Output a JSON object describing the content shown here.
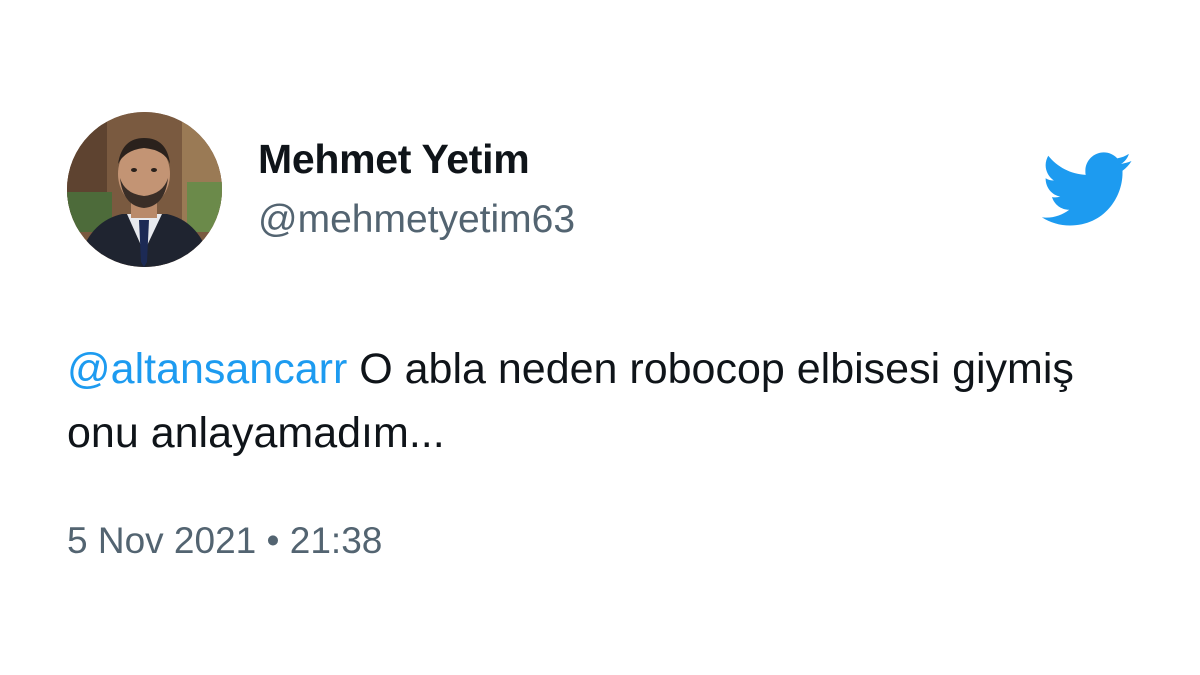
{
  "author": {
    "display_name": "Mehmet Yetim",
    "handle": "@mehmetyetim63"
  },
  "tweet": {
    "mention": "@altansancarr",
    "text": " O abla neden robocop elbisesi giymiş onu anlayamadım..."
  },
  "meta": {
    "date": "5 Nov 2021",
    "separator": " • ",
    "time": "21:38"
  },
  "icons": {
    "brand": "twitter-bird-icon"
  },
  "colors": {
    "brand_blue": "#1d9bf0",
    "text": "#0f1419",
    "muted": "#536471"
  }
}
